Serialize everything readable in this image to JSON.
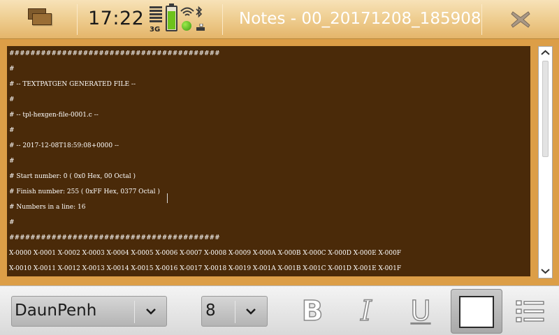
{
  "status": {
    "clock": "17:22",
    "network_type": "3G",
    "battery_level": 0.8
  },
  "window": {
    "title": "Notes - 00_20171208_185908"
  },
  "note": {
    "lines": [
      "########################################",
      "#",
      "# -- TEXTPATGEN GENERATED FILE --",
      "#",
      "# -- tpl-hexgen-file-0001.c --",
      "#",
      "# -- 2017-12-08T18:59:08+0000 --",
      "#",
      "# Start number: 0 ( 0x0 Hex, 00 Octal )",
      "# Finish number: 255 ( 0xFF Hex, 0377 Octal )",
      "# Numbers in a line: 16",
      "#",
      "########################################",
      "X-0000 X-0001 X-0002 X-0003 X-0004 X-0005 X-0006 X-0007 X-0008 X-0009 X-000A X-000B X-000C X-000D X-000E X-000F",
      "X-0010 X-0011 X-0012 X-0013 X-0014 X-0015 X-0016 X-0017 X-0018 X-0019 X-001A X-001B X-001C X-001D X-001E X-001F"
    ]
  },
  "toolbar": {
    "font_name": "DaunPenh",
    "font_size": "8",
    "bold_label": "B",
    "italic_label": "I",
    "underline_label": "U",
    "text_color": "#ffffff"
  },
  "colors": {
    "accent": "#e4b56a",
    "note_background": "#4a2a09",
    "frame": "#dc9e47"
  }
}
